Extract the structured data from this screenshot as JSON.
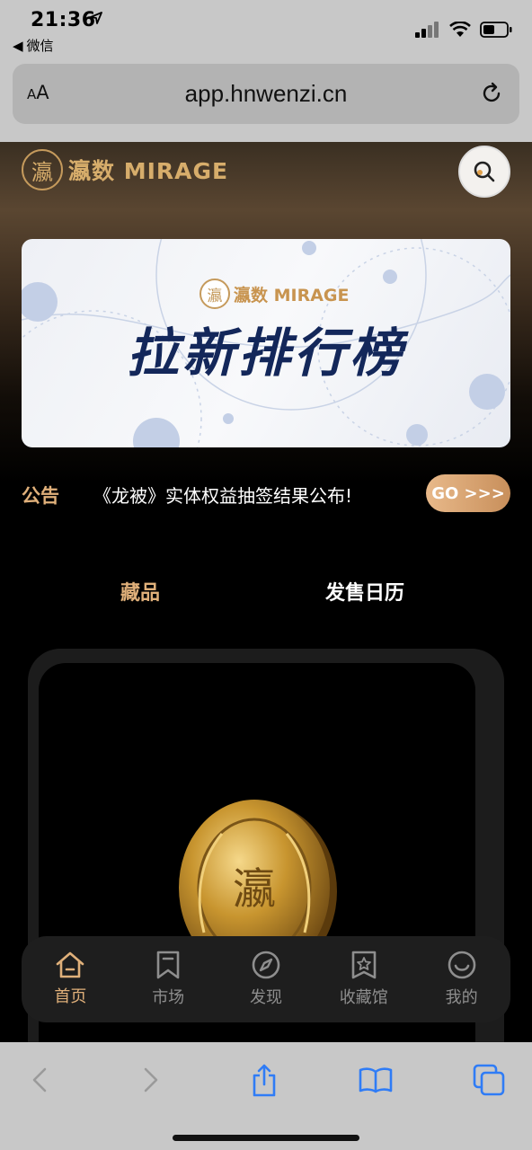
{
  "status_bar": {
    "time": "21:36",
    "back_app": "微信"
  },
  "browser": {
    "aa_label_small": "A",
    "aa_label_large": "A",
    "url": "app.hnwenzi.cn"
  },
  "header": {
    "logo_seal": "瀛",
    "logo_text": "瀛数 MIRAGE"
  },
  "banner": {
    "logo_seal": "瀛",
    "logo_text": "瀛数 MIRAGE",
    "title": "拉新排行榜"
  },
  "notice": {
    "label": "公告",
    "text": "《龙被》实体权益抽签结果公布!",
    "go_label": "GO >>>"
  },
  "tabs": [
    {
      "label": "藏品",
      "active": true
    },
    {
      "label": "发售日历",
      "active": false
    }
  ],
  "tabbar": [
    {
      "label": "首页",
      "icon": "home-icon",
      "active": true
    },
    {
      "label": "市场",
      "icon": "bookmark-icon",
      "active": false
    },
    {
      "label": "发现",
      "icon": "compass-icon",
      "active": false
    },
    {
      "label": "收藏馆",
      "icon": "star-badge-icon",
      "active": false
    },
    {
      "label": "我的",
      "icon": "smile-icon",
      "active": false
    }
  ],
  "colors": {
    "accent_gold": "#e0b07a",
    "banner_title": "#13275a",
    "ios_blue": "#2f7cf6"
  }
}
